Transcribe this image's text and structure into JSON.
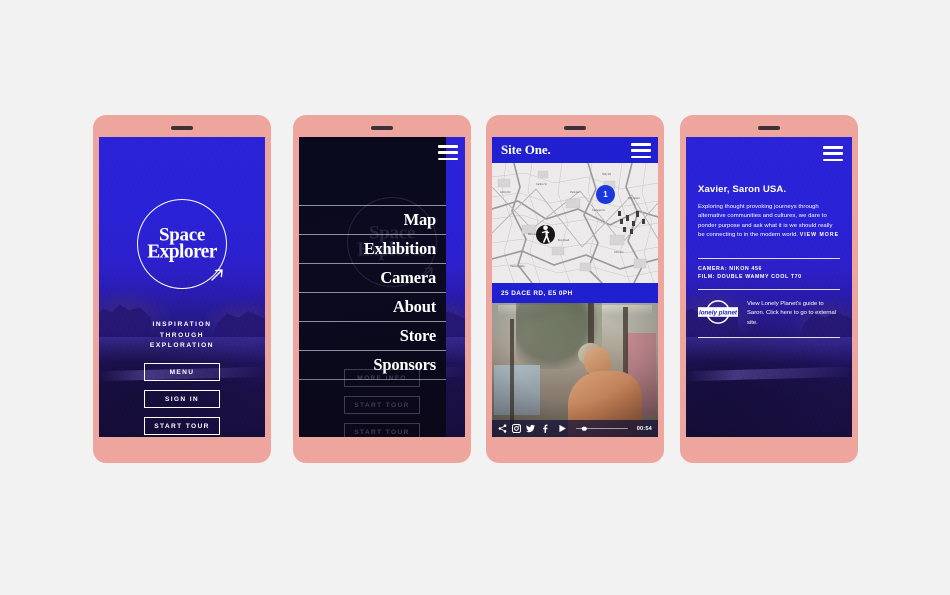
{
  "canvas": {
    "background_color": "#f2f2f2",
    "accent_blue": "#2020d0",
    "frame_pink": "#eda59d",
    "menu_dark": "#0a0a1e"
  },
  "phones": {
    "phone1": {
      "name": "splash-screen",
      "logo": {
        "line1": "Space",
        "line2": "Explorer",
        "icon": "circle-arrow-icon"
      },
      "tagline": [
        "INSPIRATION",
        "THROUGH",
        "EXPLORATION"
      ],
      "buttons": [
        {
          "label": "MENU",
          "name": "menu-button"
        },
        {
          "label": "SIGN IN",
          "name": "sign-in-button"
        },
        {
          "label": "START TOUR",
          "name": "start-tour-button"
        }
      ]
    },
    "phone2": {
      "name": "navigation-menu-screen",
      "hamburger_icon": "hamburger-icon",
      "ghost_logo": {
        "line1": "Space",
        "line2": "Explorer"
      },
      "menu_items": [
        {
          "label": "Map"
        },
        {
          "label": "Exhibition"
        },
        {
          "label": "Camera"
        },
        {
          "label": "About"
        },
        {
          "label": "Store"
        },
        {
          "label": "Sponsors"
        }
      ],
      "faded_buttons": [
        {
          "label": "MORE INFO"
        },
        {
          "label": "START TOUR"
        },
        {
          "label": "START TOUR"
        }
      ]
    },
    "phone3": {
      "name": "site-detail-map-screen",
      "header_title": "Site One.",
      "hamburger_icon": "hamburger-icon",
      "map": {
        "marker_number": "1",
        "walk_marker_icon": "walking-person-icon"
      },
      "address": "25 DACE RD, E5 0PH",
      "video_controls": {
        "icons": [
          {
            "name": "share-icon",
            "glyph": "share"
          },
          {
            "name": "instagram-icon",
            "glyph": "instagram"
          },
          {
            "name": "twitter-icon",
            "glyph": "twitter"
          },
          {
            "name": "facebook-icon",
            "glyph": "facebook"
          }
        ],
        "play_icon": "play-icon",
        "progress_percent": 16,
        "time": "00:54"
      }
    },
    "phone4": {
      "name": "story-detail-screen",
      "hamburger_icon": "hamburger-icon",
      "title": "Xavier, Saron USA.",
      "body": "Exploring thought provoking journeys through alternative communities and cultures, we dare to ponder purpose and ask what it is we should really be connecting to in the modern world. ",
      "view_more": "VIEW MORE",
      "meta": {
        "camera": "CAMERA: NIKON 456",
        "film": "FILM: DOUBLE WAMMY COOL T70"
      },
      "partner": {
        "logo_text": "lonely planet",
        "logo_name": "lonely-planet-logo",
        "text": "View Lonely Planet's guide to Saron. Click here to go to external site."
      }
    }
  }
}
